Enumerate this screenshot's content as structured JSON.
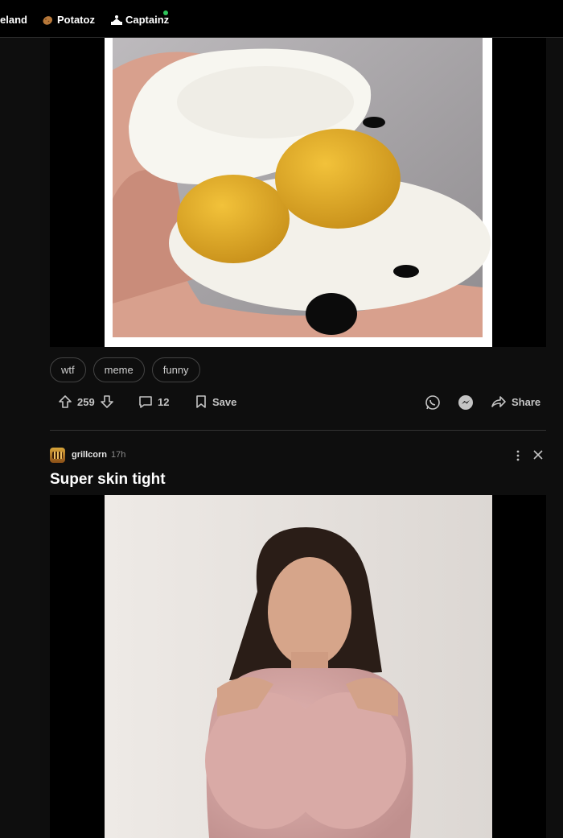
{
  "nav": {
    "items": [
      {
        "label": "eland",
        "icon": "none"
      },
      {
        "label": "Potatoz",
        "icon": "potato-icon"
      },
      {
        "label": "Captainz",
        "icon": "captain-icon",
        "badge": "online-dot"
      }
    ]
  },
  "post1": {
    "image": "two-yolk-boiled-egg",
    "tags": [
      "wtf",
      "meme",
      "funny"
    ],
    "actions": {
      "upvotes": "259",
      "comments": "12",
      "save_label": "Save",
      "share_label": "Share"
    }
  },
  "post2": {
    "author": "grillcorn",
    "age": "17h",
    "title": "Super skin tight",
    "image": "woman-in-pink-bodysuit"
  },
  "colors": {
    "background": "#0e0e0e",
    "nav_bg": "#000000",
    "online_dot": "#2ec45a",
    "text": "#e8e8e8"
  }
}
